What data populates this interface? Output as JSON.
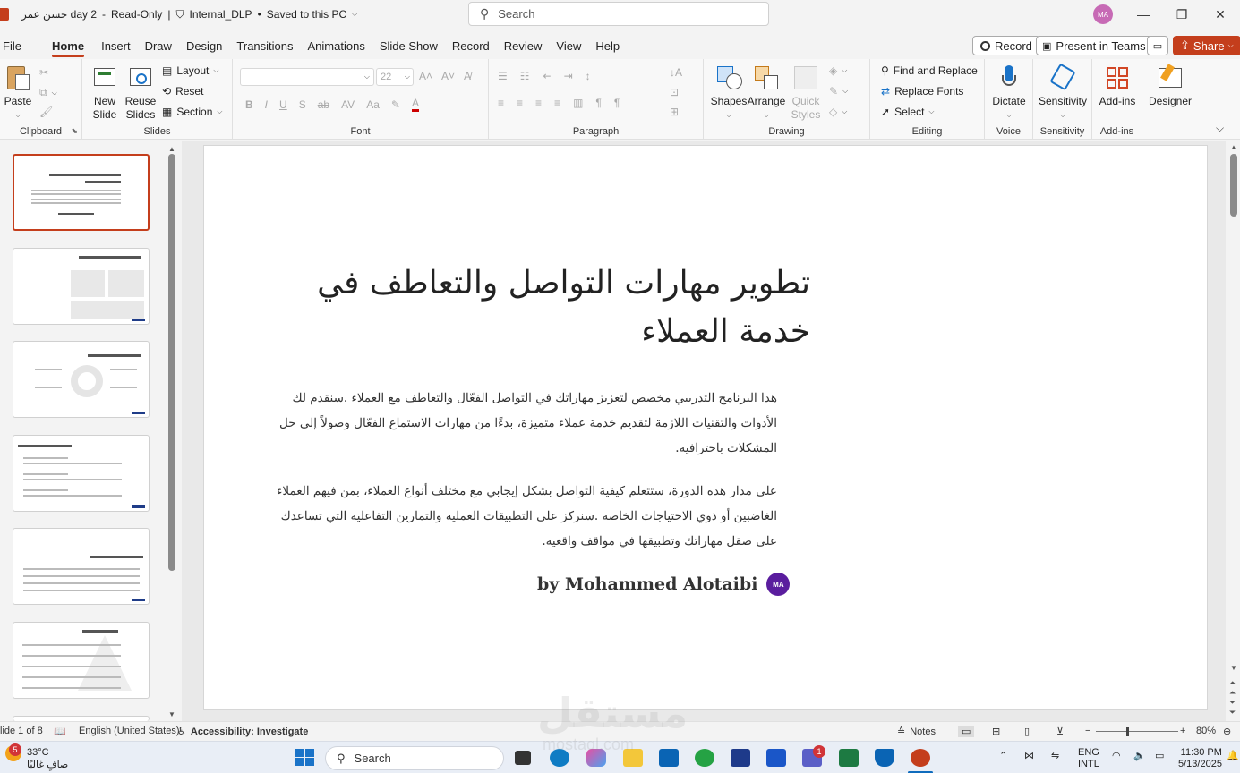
{
  "titlebar": {
    "doc_title": "حسن عمر day 2",
    "mode": "Read-Only",
    "label": "Internal_DLP",
    "saved": "Saved to this PC",
    "search_placeholder": "Search",
    "avatar": "MA"
  },
  "menu": {
    "tabs": [
      "File",
      "Home",
      "Insert",
      "Draw",
      "Design",
      "Transitions",
      "Animations",
      "Slide Show",
      "Record",
      "Review",
      "View",
      "Help"
    ],
    "active": "Home",
    "record": "Record",
    "present": "Present in Teams",
    "share": "Share"
  },
  "ribbon": {
    "clipboard": {
      "label": "Clipboard",
      "paste": "Paste"
    },
    "slides": {
      "label": "Slides",
      "new_slide": "New Slide",
      "reuse": "Reuse Slides",
      "layout": "Layout",
      "reset": "Reset",
      "section": "Section"
    },
    "font": {
      "label": "Font",
      "size": "22"
    },
    "paragraph": {
      "label": "Paragraph"
    },
    "drawing": {
      "label": "Drawing",
      "shapes": "Shapes",
      "arrange": "Arrange",
      "quick_styles": "Quick Styles"
    },
    "editing": {
      "label": "Editing",
      "find_replace": "Find and Replace",
      "replace_fonts": "Replace Fonts",
      "select": "Select"
    },
    "voice": {
      "label": "Voice",
      "dictate": "Dictate"
    },
    "sensitivity": {
      "label": "Sensitivity",
      "button": "Sensitivity"
    },
    "addins": {
      "label": "Add-ins",
      "button": "Add-ins"
    },
    "designer": {
      "button": "Designer"
    }
  },
  "slide": {
    "title_line1": "تطوير مهارات التواصل والتعاطف في",
    "title_line2": "خدمة العملاء",
    "para1": "هذا البرنامج التدريبي مخصص لتعزيز مهاراتك في التواصل الفعّال والتعاطف مع العملاء .سنقدم لك الأدوات والتقنيات اللازمة لتقديم خدمة عملاء متميزة، بدءًا من مهارات الاستماع الفعّال وصولاً إلى حل المشكلات باحترافية.",
    "para2": "على مدار هذه الدورة، ستتعلم كيفية التواصل بشكل إيجابي مع مختلف أنواع العملاء، بمن فيهم العملاء الغاضبين أو ذوي الاحتياجات الخاصة .سنركز على التطبيقات العملية والتمارين التفاعلية التي تساعدك على صقل مهاراتك وتطبيقها في مواقف واقعية.",
    "byline": "by Mohammed  Alotaibi",
    "byline_avatar": "MA"
  },
  "statusbar": {
    "slide_info": "lide 1 of 8",
    "language": "English (United States)",
    "accessibility": "Accessibility: Investigate",
    "notes": "Notes",
    "zoom": "80%"
  },
  "taskbar": {
    "temp": "33°C",
    "weather": "صافٍ غالبًا",
    "weather_badge": "5",
    "search": "Search",
    "lang1": "ENG",
    "lang2": "INTL",
    "time": "11:30 PM",
    "date": "5/13/2025",
    "teams_badge": "1"
  },
  "watermark": {
    "text": "مستقل",
    "sub": "mostaql.com"
  },
  "colors": {
    "accent": "#c43e1c",
    "avatar": "#5a1d9e"
  }
}
